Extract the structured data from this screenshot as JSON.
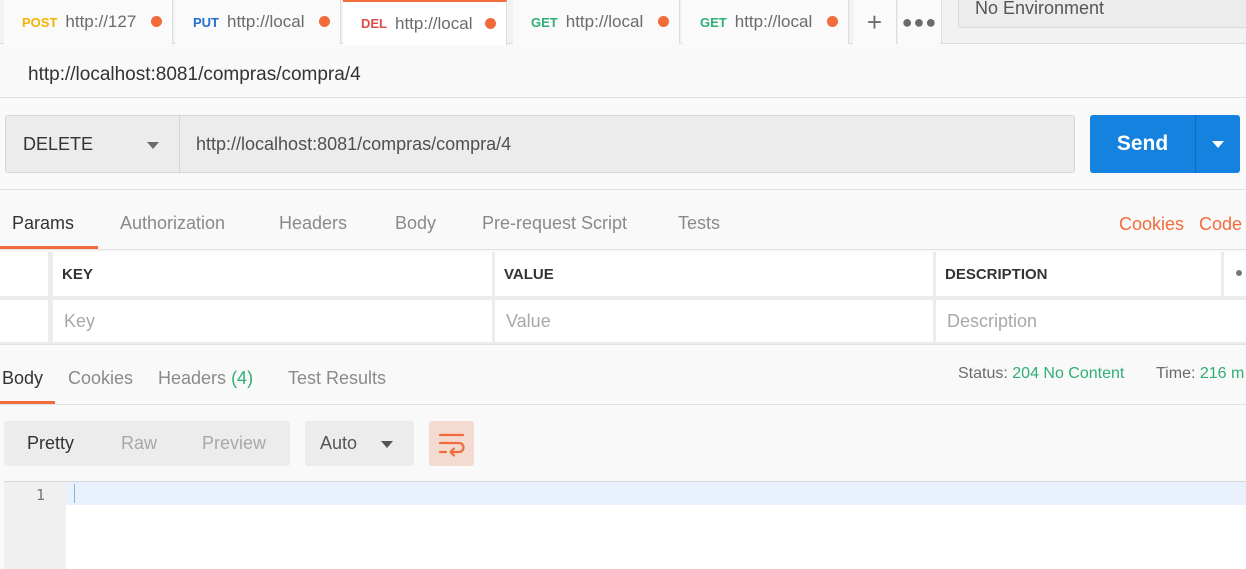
{
  "tabs": [
    {
      "method": "POST",
      "label": "http://127"
    },
    {
      "method": "PUT",
      "label": "http://local"
    },
    {
      "method": "DEL",
      "label": "http://local"
    },
    {
      "method": "GET",
      "label": "http://local"
    },
    {
      "method": "GET",
      "label": "http://local"
    }
  ],
  "environment": {
    "selected": "No Environment"
  },
  "request": {
    "name": "http://localhost:8081/compras/compra/4",
    "method": "DELETE",
    "url": "http://localhost:8081/compras/compra/4",
    "send_label": "Send"
  },
  "request_tabs": [
    "Params",
    "Authorization",
    "Headers",
    "Body",
    "Pre-request Script",
    "Tests"
  ],
  "request_links": {
    "cookies": "Cookies",
    "code": "Code"
  },
  "params_table": {
    "headers": {
      "key": "KEY",
      "value": "VALUE",
      "description": "DESCRIPTION"
    },
    "placeholders": {
      "key": "Key",
      "value": "Value",
      "description": "Description"
    }
  },
  "response": {
    "tabs": {
      "body": "Body",
      "cookies": "Cookies",
      "headers": "Headers",
      "headers_count": "(4)",
      "tests": "Test Results"
    },
    "status_label": "Status:",
    "status_value": "204 No Content",
    "time_label": "Time:",
    "time_value": "216 m"
  },
  "response_toolbar": {
    "modes": [
      "Pretty",
      "Raw",
      "Preview"
    ],
    "format": "Auto"
  },
  "editor": {
    "line_number": "1"
  },
  "colors": {
    "accent": "#f26b3a",
    "send": "#1582e0",
    "success": "#2fae77"
  }
}
